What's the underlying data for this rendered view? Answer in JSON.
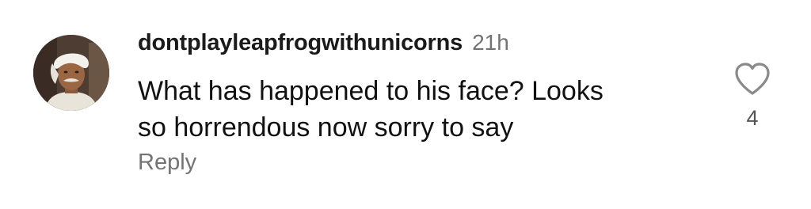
{
  "comment": {
    "username": "dontplayleapfrogwithunicorns",
    "timestamp": "21h",
    "line1": "What has happened to his face? Looks",
    "line2": "so horrendous now sorry to say",
    "reply_label": "Reply",
    "like_count": "4",
    "avatar_icon": "profile-photo",
    "like_icon": "heart-outline-icon"
  }
}
